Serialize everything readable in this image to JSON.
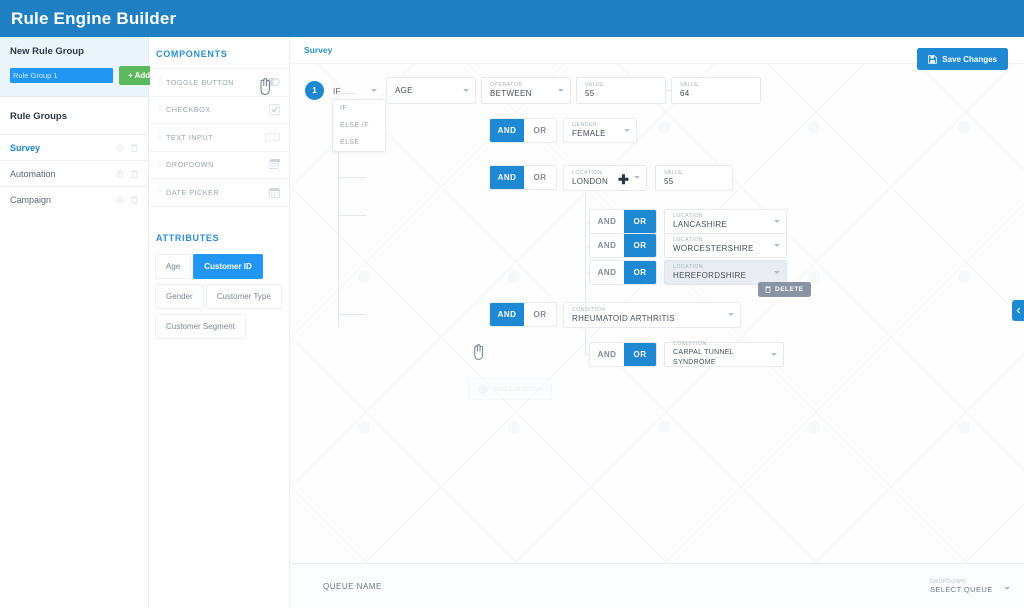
{
  "header": {
    "title": "Rule Engine Builder"
  },
  "sidebar": {
    "new_group": {
      "heading": "New Rule Group",
      "input_value": "Rule Group 1",
      "add_label": "+ Add"
    },
    "groups_heading": "Rule Groups",
    "groups": [
      {
        "label": "Survey",
        "active": true
      },
      {
        "label": "Automation",
        "active": false
      },
      {
        "label": "Campaign",
        "active": false
      }
    ],
    "row_icons": [
      "gear-icon",
      "trash-icon"
    ]
  },
  "palette": {
    "components_heading": "COMPONENTS",
    "components": [
      {
        "label": "TOGGLE BUTTON",
        "icon": "toggle-switch-icon"
      },
      {
        "label": "CHECKBOX",
        "icon": "checkbox-icon"
      },
      {
        "label": "TEXT INPUT",
        "icon": "text-input-icon"
      },
      {
        "label": "DROPDOWN",
        "icon": "dropdown-icon"
      },
      {
        "label": "DATE PICKER",
        "icon": "calendar-icon"
      }
    ],
    "attributes_heading": "ATTRIBUTES",
    "attributes": [
      {
        "label": "Age",
        "selected": false
      },
      {
        "label": "Customer ID",
        "selected": true
      },
      {
        "label": "Gender",
        "selected": false
      },
      {
        "label": "Customer Type",
        "selected": false
      },
      {
        "label": "Customer Segment",
        "selected": false
      }
    ]
  },
  "canvas": {
    "breadcrumb": "Survey",
    "save_label": "Save Changes",
    "step_badge": "1",
    "if_selector": {
      "value": "IF",
      "options": [
        "IF",
        "ELSE IF",
        "ELSE"
      ]
    },
    "rows": {
      "age": {
        "caption": "",
        "value": "AGE"
      },
      "operator": {
        "caption": "OPERATOR",
        "value": "BETWEEN"
      },
      "value_min": {
        "caption": "VALUE",
        "value": "55"
      },
      "value_max": {
        "caption": "VALUE",
        "value": "64"
      },
      "gender": {
        "caption": "GENDER",
        "value": "FEMALE",
        "and_label": "AND",
        "or_label": "OR",
        "active": "AND"
      },
      "location_main": {
        "caption": "LOCATION",
        "value": "LONDON",
        "and_label": "AND",
        "or_label": "OR",
        "active": "AND"
      },
      "location_value": {
        "caption": "VALUE",
        "value": "55"
      },
      "nested_locations": [
        {
          "caption": "LOCATION",
          "value": "LANCASHIRE",
          "and_label": "AND",
          "or_label": "OR",
          "active": "OR",
          "highlight": false
        },
        {
          "caption": "LOCATION",
          "value": "WORCESTERSHIRE",
          "and_label": "AND",
          "or_label": "OR",
          "active": "OR",
          "highlight": false
        },
        {
          "caption": "LOCATION",
          "value": "HEREFORDSHIRE",
          "and_label": "AND",
          "or_label": "OR",
          "active": "OR",
          "highlight": true
        }
      ],
      "condition_main": {
        "caption": "CONDITION",
        "value": "RHEUMATOID ARTHRITIS",
        "and_label": "AND",
        "or_label": "OR",
        "active": "AND"
      },
      "condition_nested": {
        "caption": "CONDITION",
        "value": "CARPAL TUNNEL SYNDROME",
        "and_label": "AND",
        "or_label": "OR",
        "active": "OR"
      }
    },
    "delete_tooltip": "DELETE",
    "add_condition_ghost": "Add Condition"
  },
  "bottom_bar": {
    "queue_label": "QUEUE NAME",
    "queue_select": {
      "caption": "DROPDOWN",
      "value": "SELECT QUEUE"
    }
  },
  "colors": {
    "brand_blue": "#1e7fc2",
    "accent_blue": "#1e88d2",
    "add_green": "#5cb85c",
    "tooltip_grey": "#8894a5"
  }
}
